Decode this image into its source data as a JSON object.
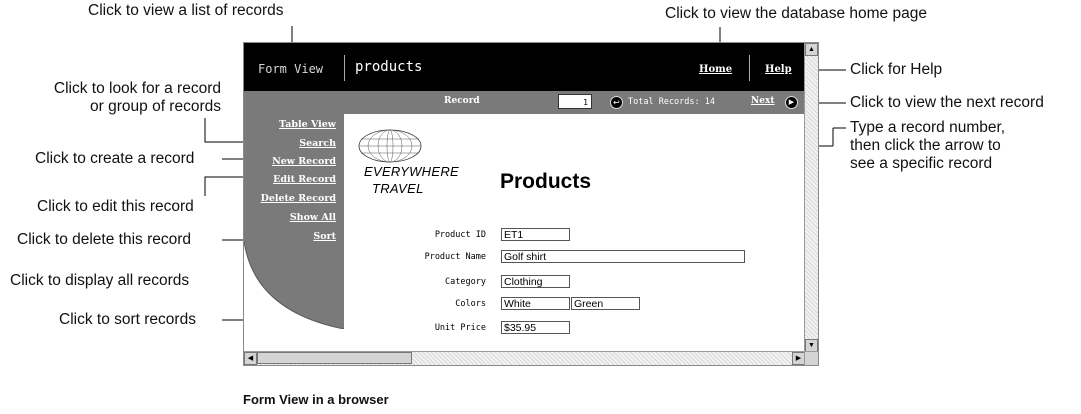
{
  "callouts": {
    "list_records": "Click to view a list of records",
    "db_home": "Click to view the database home page",
    "help": "Click for Help",
    "search_line1": "Click to look for a record",
    "search_line2": "or group of records",
    "next_record": "Click to view the next record",
    "create": "Click to create a record",
    "type_line1": "Type a record number,",
    "type_line2": "then click the arrow to",
    "type_line3": "see a specific record",
    "edit": "Click to edit this record",
    "delete": "Click to delete this record",
    "show_all": "Click to display all records",
    "sort": "Click to sort records"
  },
  "window": {
    "view_label": "Form View",
    "table_name": "products",
    "home_link": "Home",
    "help_link": "Help"
  },
  "record_bar": {
    "record_label": "Record",
    "record_value": "1",
    "go_arrow": "↩",
    "total": "Total Records: 14",
    "next_label": "Next",
    "next_arrow": "▶"
  },
  "sidebar": {
    "items": [
      {
        "label": "Table View"
      },
      {
        "label": "Search"
      },
      {
        "label": "New Record"
      },
      {
        "label": "Edit Record"
      },
      {
        "label": "Delete Record"
      },
      {
        "label": "Show All"
      },
      {
        "label": "Sort"
      }
    ]
  },
  "brand": {
    "line1": "EVERYWHERE",
    "line2": "TRAVEL"
  },
  "form": {
    "title": "Products",
    "fields": [
      {
        "label": "Product ID",
        "value": "ET1"
      },
      {
        "label": "Product Name",
        "value": "Golf shirt"
      },
      {
        "label": "Category",
        "value": "Clothing"
      },
      {
        "label": "Colors",
        "value": "White",
        "value2": "Green"
      },
      {
        "label": "Unit Price",
        "value": "$35.95"
      }
    ]
  },
  "scrollbar": {
    "up": "▲",
    "down": "▼",
    "left": "◀",
    "right": "▶"
  },
  "caption": "Form View in a browser"
}
